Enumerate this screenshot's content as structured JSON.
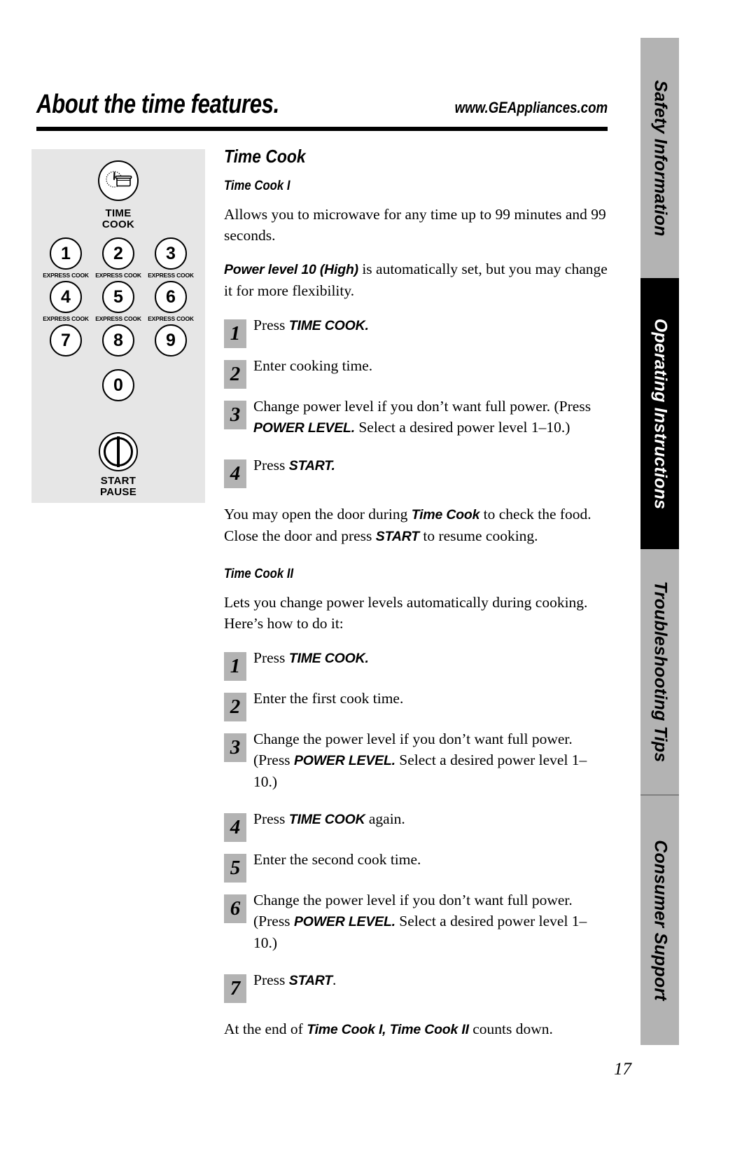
{
  "header": {
    "title": "About the time features.",
    "url": "www.GEAppliances.com"
  },
  "control_panel": {
    "time_cook_icon": "clock-and-food-container-icon",
    "time_cook_label_line1": "TIME",
    "time_cook_label_line2": "COOK",
    "keys": [
      {
        "digit": "1",
        "sub": "EXPRESS COOK"
      },
      {
        "digit": "2",
        "sub": "EXPRESS COOK"
      },
      {
        "digit": "3",
        "sub": "EXPRESS COOK"
      },
      {
        "digit": "4",
        "sub": "EXPRESS COOK"
      },
      {
        "digit": "5",
        "sub": "EXPRESS COOK"
      },
      {
        "digit": "6",
        "sub": "EXPRESS COOK"
      },
      {
        "digit": "7",
        "sub": ""
      },
      {
        "digit": "8",
        "sub": ""
      },
      {
        "digit": "9",
        "sub": ""
      }
    ],
    "zero_key": {
      "digit": "0",
      "sub": ""
    },
    "start_icon": "power-bar-icon",
    "start_label_line1": "START",
    "start_label_line2": "PAUSE"
  },
  "main": {
    "heading": "Time Cook",
    "section1": {
      "heading": "Time Cook I",
      "intro": "Allows you to microwave for any time up to 99 minutes and 99 seconds.",
      "power_note_bold": "Power level 10 (High)",
      "power_note_rest": " is automatically set, but you may change it for more flexibility.",
      "steps": [
        {
          "num": "1",
          "pre": "Press ",
          "cmd": "TIME COOK.",
          "post": ""
        },
        {
          "num": "2",
          "pre": "Enter cooking time.",
          "cmd": "",
          "post": ""
        },
        {
          "num": "3",
          "pre": "Change power level if you don’t want full power. (Press ",
          "cmd": "POWER LEVEL.",
          "post": " Select a desired power level 1–10.)"
        },
        {
          "num": "4",
          "pre": "Press ",
          "cmd": "START.",
          "post": ""
        }
      ],
      "closing_p1": "You may open the door during ",
      "closing_b1": "Time Cook",
      "closing_p2": " to check the food. Close the door and press ",
      "closing_b2": "START",
      "closing_p3": " to resume cooking."
    },
    "section2": {
      "heading": "Time Cook II",
      "intro": "Lets you change power levels automatically during cooking. Here’s how to do it:",
      "steps": [
        {
          "num": "1",
          "pre": "Press ",
          "cmd": "TIME COOK.",
          "post": ""
        },
        {
          "num": "2",
          "pre": "Enter the first cook time.",
          "cmd": "",
          "post": ""
        },
        {
          "num": "3",
          "pre": "Change the power level if you don’t want full power. (Press ",
          "cmd": "POWER LEVEL.",
          "post": " Select a desired power level 1–10.)"
        },
        {
          "num": "4",
          "pre": "Press ",
          "cmd": "TIME COOK",
          "post": " again."
        },
        {
          "num": "5",
          "pre": "Enter the second cook time.",
          "cmd": "",
          "post": ""
        },
        {
          "num": "6",
          "pre": "Change the power level if you don’t want full power. (Press ",
          "cmd": "POWER LEVEL.",
          "post": " Select a desired power level 1–10.)"
        },
        {
          "num": "7",
          "pre": "Press ",
          "cmd": "START",
          "post": "."
        }
      ],
      "closing_p1": "At the end of ",
      "closing_b1": "Time Cook I, Time Cook II",
      "closing_p2": " counts down."
    }
  },
  "sidebar": {
    "tabs": [
      {
        "label": "Safety Information",
        "active": false
      },
      {
        "label": "Operating Instructions",
        "active": true
      },
      {
        "label": "Troubleshooting Tips",
        "active": false
      },
      {
        "label": "Consumer Support",
        "active": false
      }
    ]
  },
  "footer": {
    "page_number": "17"
  },
  "colors": {
    "tab_inactive": "#b3b3b3",
    "tab_active": "#000000",
    "panel_bg": "#e6e6e6",
    "step_box": "#b3b3b3"
  }
}
